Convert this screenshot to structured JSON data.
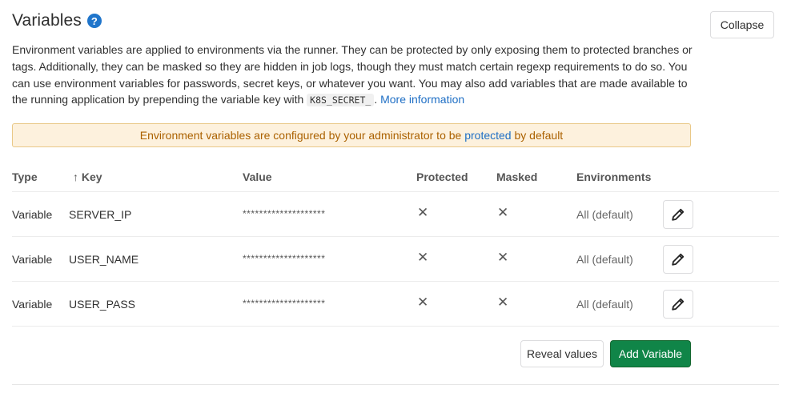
{
  "header": {
    "title": "Variables",
    "help_icon": "question-circle-icon"
  },
  "collapse_label": "Collapse",
  "description": {
    "text_before": "Environment variables are applied to environments via the runner. They can be protected by only exposing them to protected branches or tags. Additionally, they can be masked so they are hidden in job logs, though they must match certain regexp requirements to do so. You can use environment variables for passwords, secret keys, or whatever you want. You may also add variables that are made available to the running application by prepending the variable key with ",
    "code": "K8S_SECRET_",
    "text_after": ". ",
    "link": "More information"
  },
  "alert": {
    "before": "Environment variables are configured by your administrator to be ",
    "link": "protected",
    "after": " by default"
  },
  "table": {
    "headers": {
      "type": "Type",
      "key_arrow": "↑",
      "key": "Key",
      "value": "Value",
      "protected": "Protected",
      "masked": "Masked",
      "environments": "Environments"
    },
    "rows": [
      {
        "type": "Variable",
        "key": "SERVER_IP",
        "value": "********************",
        "protected": "✕",
        "masked": "✕",
        "environment": "All (default)"
      },
      {
        "type": "Variable",
        "key": "USER_NAME",
        "value": "********************",
        "protected": "✕",
        "masked": "✕",
        "environment": "All (default)"
      },
      {
        "type": "Variable",
        "key": "USER_PASS",
        "value": "********************",
        "protected": "✕",
        "masked": "✕",
        "environment": "All (default)"
      }
    ]
  },
  "actions": {
    "reveal": "Reveal values",
    "add": "Add Variable"
  },
  "colors": {
    "primary_link": "#1f6fc5",
    "success_button": "#108548",
    "alert_bg": "#fdf1dd",
    "alert_text": "#ab6100"
  }
}
